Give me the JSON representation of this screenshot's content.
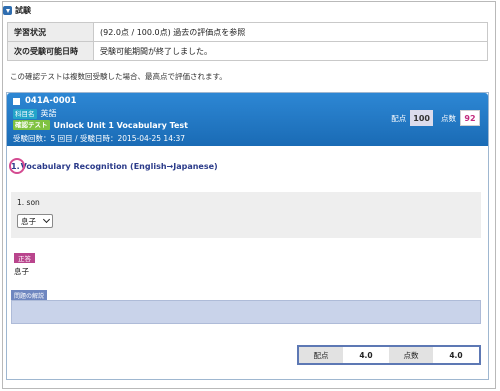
{
  "section": {
    "title": "試験"
  },
  "info_table": [
    {
      "label": "学習状況",
      "value": "(92.0点 / 100.0点) 過去の評価点を参照"
    },
    {
      "label": "次の受験可能日時",
      "value": "受験可能期間が終了しました。"
    }
  ],
  "note": "この確認テストは複数回受験した場合、最高点で評価されます。",
  "test": {
    "code": "041A-0001",
    "subject_badge": "科目名",
    "subject": "英語",
    "test_badge": "確認テスト",
    "test_name": "Unlock Unit 1 Vocabulary Test",
    "attempts": "受験回数：5 回目 / 受験日時：2015-04-25 14:37",
    "max_label": "配点",
    "max_value": "100",
    "score_label": "点数",
    "score_value": "92"
  },
  "question": {
    "number": "1.",
    "title": "Vocabulary Recognition (English→Japanese)",
    "item": "1. son",
    "selected": "息子",
    "correct_badge": "正答",
    "correct_answer": "息子",
    "explanation_tab": "問題の解説",
    "explanation": ""
  },
  "footer": {
    "points_label": "配点",
    "points_value": "4.0",
    "score_label": "点数",
    "score_value": "4.0"
  },
  "colors": {
    "band": "#1f78c6",
    "score_accent": "#c22a7c",
    "correct_badge": "#b9458d",
    "footer_frame": "#5d78b4"
  }
}
